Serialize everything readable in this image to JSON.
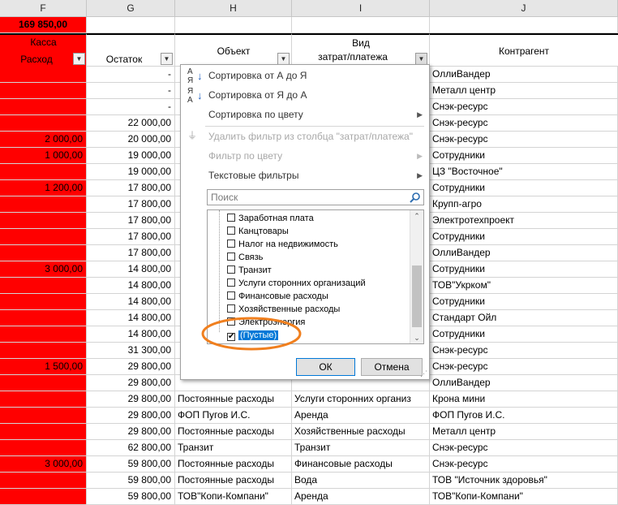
{
  "columns": {
    "f": "F",
    "g": "G",
    "h": "H",
    "i": "I",
    "j": "J"
  },
  "header": {
    "f_total": "169 850,00",
    "f_kassa": "Касса",
    "f_rashod": "Расход",
    "g_ostatok": "Остаток",
    "h_obekt": "Объект",
    "i_vid_line1": "Вид",
    "i_vid_line2": "затрат/платежа",
    "j_kontragent": "Контрагент"
  },
  "rows": [
    {
      "f": "",
      "g": "-",
      "h": "",
      "i": "",
      "j": "ОллиВандер"
    },
    {
      "f": "",
      "g": "-",
      "h": "",
      "i": "",
      "j": "Металл центр"
    },
    {
      "f": "",
      "g": "-",
      "h": "",
      "i": "",
      "j": "Снэк-ресурс"
    },
    {
      "f": "",
      "g": "22 000,00",
      "h": "",
      "i": "",
      "j": "Снэк-ресурс"
    },
    {
      "f": "2 000,00",
      "g": "20 000,00",
      "h": "",
      "i": "",
      "j": "Снэк-ресурс"
    },
    {
      "f": "1 000,00",
      "g": "19 000,00",
      "h": "",
      "i": "",
      "j": "Сотрудники"
    },
    {
      "f": "",
      "g": "19 000,00",
      "h": "",
      "i": "",
      "j": "ЦЗ \"Восточное\""
    },
    {
      "f": "1 200,00",
      "g": "17 800,00",
      "h": "",
      "i": "",
      "j": "Сотрудники"
    },
    {
      "f": "",
      "g": "17 800,00",
      "h": "",
      "i": "",
      "j": "Крупп-агро"
    },
    {
      "f": "",
      "g": "17 800,00",
      "h": "",
      "i": "",
      "j": "Электротехпроект"
    },
    {
      "f": "",
      "g": "17 800,00",
      "h": "",
      "i": "",
      "j": "Сотрудники"
    },
    {
      "f": "",
      "g": "17 800,00",
      "h": "",
      "i": "",
      "j": "ОллиВандер"
    },
    {
      "f": "3 000,00",
      "g": "14 800,00",
      "h": "",
      "i": "",
      "j": "Сотрудники"
    },
    {
      "f": "",
      "g": "14 800,00",
      "h": "",
      "i": "",
      "j": "ТОВ\"Укрком\""
    },
    {
      "f": "",
      "g": "14 800,00",
      "h": "",
      "i": "",
      "j": "Сотрудники"
    },
    {
      "f": "",
      "g": "14 800,00",
      "h": "",
      "i": "",
      "j": "Стандарт Ойл"
    },
    {
      "f": "",
      "g": "14 800,00",
      "h": "",
      "i": "",
      "j": "Сотрудники"
    },
    {
      "f": "",
      "g": "31 300,00",
      "h": "",
      "i": "",
      "j": "Снэк-ресурс"
    },
    {
      "f": "1 500,00",
      "g": "29 800,00",
      "h": "",
      "i": "",
      "j": "Снэк-ресурс"
    },
    {
      "f": "",
      "g": "29 800,00",
      "h": "",
      "i": "",
      "j": "ОллиВандер"
    },
    {
      "f": "",
      "g": "29 800,00",
      "h": "Постоянные расходы",
      "i": "Услуги сторонних организ",
      "j": "Крона мини"
    },
    {
      "f": "",
      "g": "29 800,00",
      "h": "ФОП Пугов И.С.",
      "i": "Аренда",
      "j": "ФОП Пугов И.С."
    },
    {
      "f": "",
      "g": "29 800,00",
      "h": "Постоянные расходы",
      "i": "Хозяйственные расходы",
      "j": "Металл центр"
    },
    {
      "f": "",
      "g": "62 800,00",
      "h": "Транзит",
      "i": "Транзит",
      "j": "Снэк-ресурс"
    },
    {
      "f": "3 000,00",
      "g": "59 800,00",
      "h": "Постоянные расходы",
      "i": "Финансовые расходы",
      "j": "Снэк-ресурс"
    },
    {
      "f": "",
      "g": "59 800,00",
      "h": "Постоянные расходы",
      "i": "Вода",
      "j": "ТОВ \"Источник здоровья\""
    },
    {
      "f": "",
      "g": "59 800,00",
      "h": "ТОВ\"Копи-Компани\"",
      "i": "Аренда",
      "j": "ТОВ\"Копи-Компани\""
    }
  ],
  "filter_menu": {
    "sort_az": "Сортировка от А до Я",
    "sort_za": "Сортировка от Я до А",
    "sort_color": "Сортировка по цвету",
    "clear_filter": "Удалить фильтр из столбца \"затрат/платежа\"",
    "filter_color": "Фильтр по цвету",
    "text_filters": "Текстовые фильтры",
    "search_placeholder": "Поиск",
    "items": [
      {
        "label": "Заработная плата",
        "checked": false
      },
      {
        "label": "Канцтовары",
        "checked": false
      },
      {
        "label": "Налог на недвижимость",
        "checked": false
      },
      {
        "label": "Связь",
        "checked": false
      },
      {
        "label": "Транзит",
        "checked": false
      },
      {
        "label": "Услуги сторонних организаций",
        "checked": false
      },
      {
        "label": "Финансовые расходы",
        "checked": false
      },
      {
        "label": "Хозяйственные расходы",
        "checked": false
      },
      {
        "label": "Электроэнергия",
        "checked": false
      },
      {
        "label": "(Пустые)",
        "checked": true
      }
    ],
    "ok": "ОК",
    "cancel": "Отмена",
    "sort_az_icon_top": "А",
    "sort_az_icon_bottom": "Я",
    "sort_za_icon_top": "Я",
    "sort_za_icon_bottom": "А"
  },
  "colors": {
    "red": "#ff0000",
    "highlight_circle": "#f07f1e",
    "selection": "#0078d7"
  }
}
